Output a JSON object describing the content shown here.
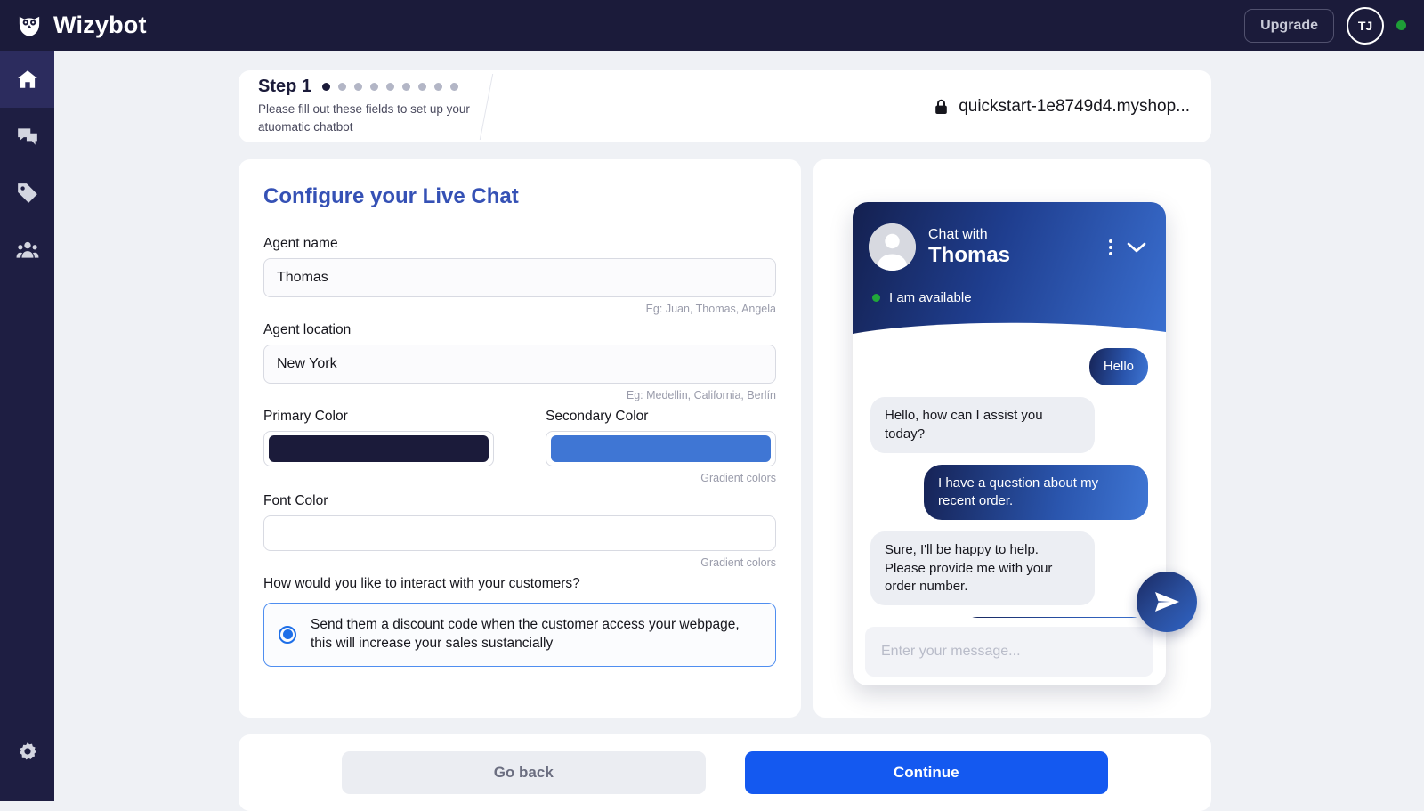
{
  "topbar": {
    "brand": "Wizybot",
    "logo_icon": "owl-icon",
    "upgrade_label": "Upgrade",
    "avatar_initials": "TJ",
    "online_dot_color": "#1e9e37"
  },
  "sidebar": {
    "items": [
      {
        "icon": "home-icon",
        "name": "home",
        "active": true
      },
      {
        "icon": "chat-bubbles-icon",
        "name": "conversations",
        "active": false
      },
      {
        "icon": "tag-icon",
        "name": "products",
        "active": false
      },
      {
        "icon": "people-icon",
        "name": "customers",
        "active": false
      }
    ],
    "bottom": {
      "icon": "gear-icon",
      "name": "settings"
    }
  },
  "step": {
    "title": "Step 1",
    "subtitle": "Please fill out these fields to set up your atuomatic chatbot",
    "total_dots": 9,
    "active_dot_index": 0,
    "store_url": "quickstart-1e8749d4.myshop...",
    "lock_icon": "lock-icon"
  },
  "form": {
    "title": "Configure your Live Chat",
    "agent_name": {
      "label": "Agent name",
      "value": "Thomas",
      "placeholder": "Agent name",
      "hint": "Eg: Juan, Thomas, Angela"
    },
    "agent_location": {
      "label": "Agent location",
      "value": "New York",
      "placeholder": "Agent location",
      "hint": "Eg: Medellin, California, Berlín"
    },
    "primary_color": {
      "label": "Primary Color",
      "value": "#1b1b3a"
    },
    "secondary_color": {
      "label": "Secondary Color",
      "value": "#3f76d4",
      "hint": "Gradient colors"
    },
    "font_color": {
      "label": "Font Color",
      "value": "#ffffff",
      "hint": "Gradient colors"
    },
    "interaction": {
      "question": "How would you like to interact with your customers?",
      "option_label": "Send them a discount code when the customer access your webpage, this will increase your sales sustancially",
      "selected": true
    }
  },
  "preview": {
    "header": {
      "chat_with_label": "Chat with",
      "agent_name": "Thomas",
      "avatar_icon": "user-avatar-icon",
      "menu_icon": "kebab-menu-icon",
      "collapse_icon": "chevron-down-icon",
      "status_text": "I am available",
      "status_dot_color": "#21a83a"
    },
    "messages": [
      {
        "from": "user",
        "text": "Hello"
      },
      {
        "from": "bot",
        "text": "Hello, how can I assist you today?"
      },
      {
        "from": "user",
        "text": "I have a question about my recent order."
      },
      {
        "from": "bot",
        "text": "Sure, I'll be happy to help. Please provide me with your order number."
      }
    ],
    "input_placeholder": "Enter your message...",
    "input_value": "",
    "send_icon": "send-paper-plane-icon"
  },
  "footer": {
    "back_label": "Go back",
    "continue_label": "Continue"
  }
}
